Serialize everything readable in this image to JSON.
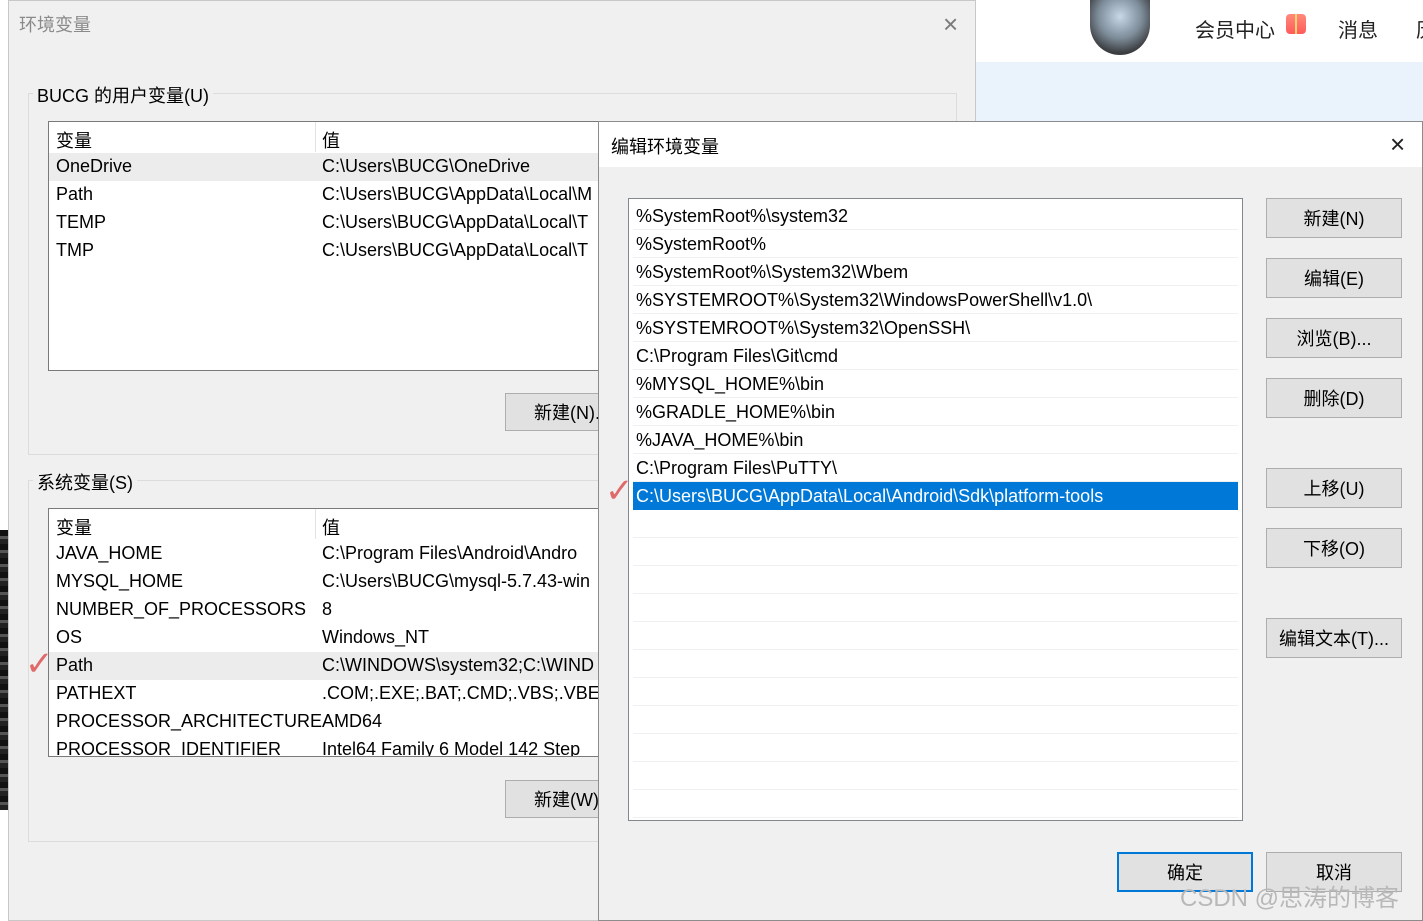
{
  "website": {
    "nav": {
      "member_center": "会员中心",
      "messages": "消息",
      "partial_item": "历"
    }
  },
  "env_window": {
    "title": "环境变量",
    "user_section": {
      "label": "BUCG 的用户变量(U)",
      "headers": {
        "variable": "变量",
        "value": "值"
      },
      "rows": [
        {
          "name": "OneDrive",
          "value": "C:\\Users\\BUCG\\OneDrive"
        },
        {
          "name": "Path",
          "value": "C:\\Users\\BUCG\\AppData\\Local\\M"
        },
        {
          "name": "TEMP",
          "value": "C:\\Users\\BUCG\\AppData\\Local\\T"
        },
        {
          "name": "TMP",
          "value": "C:\\Users\\BUCG\\AppData\\Local\\T"
        }
      ],
      "new_button": "新建(N)..."
    },
    "system_section": {
      "label": "系统变量(S)",
      "headers": {
        "variable": "变量",
        "value": "值"
      },
      "rows": [
        {
          "name": "JAVA_HOME",
          "value": "C:\\Program Files\\Android\\Andro"
        },
        {
          "name": "MYSQL_HOME",
          "value": "C:\\Users\\BUCG\\mysql-5.7.43-win"
        },
        {
          "name": "NUMBER_OF_PROCESSORS",
          "value": "8"
        },
        {
          "name": "OS",
          "value": "Windows_NT"
        },
        {
          "name": "Path",
          "value": "C:\\WINDOWS\\system32;C:\\WIND"
        },
        {
          "name": "PATHEXT",
          "value": ".COM;.EXE;.BAT;.CMD;.VBS;.VBE;.J"
        },
        {
          "name": "PROCESSOR_ARCHITECTURE",
          "value": "AMD64"
        },
        {
          "name": "PROCESSOR_IDENTIFIER",
          "value": "Intel64 Family 6 Model 142 Step"
        }
      ],
      "new_button": "新建(W)..."
    }
  },
  "edit_dialog": {
    "title": "编辑环境变量",
    "entries": [
      "%SystemRoot%\\system32",
      "%SystemRoot%",
      "%SystemRoot%\\System32\\Wbem",
      "%SYSTEMROOT%\\System32\\WindowsPowerShell\\v1.0\\",
      "%SYSTEMROOT%\\System32\\OpenSSH\\",
      "C:\\Program Files\\Git\\cmd",
      "%MYSQL_HOME%\\bin",
      "%GRADLE_HOME%\\bin",
      "%JAVA_HOME%\\bin",
      "C:\\Program Files\\PuTTY\\",
      "C:\\Users\\BUCG\\AppData\\Local\\Android\\Sdk\\platform-tools"
    ],
    "buttons": {
      "new": "新建(N)",
      "edit": "编辑(E)",
      "browse": "浏览(B)...",
      "delete": "删除(D)",
      "move_up": "上移(U)",
      "move_down": "下移(O)",
      "edit_text": "编辑文本(T)...",
      "ok": "确定",
      "cancel": "取消"
    }
  },
  "watermark": "CSDN @思涛的博客",
  "colors": {
    "selection": "#0078d7",
    "check_mark": "#e06a6a"
  }
}
